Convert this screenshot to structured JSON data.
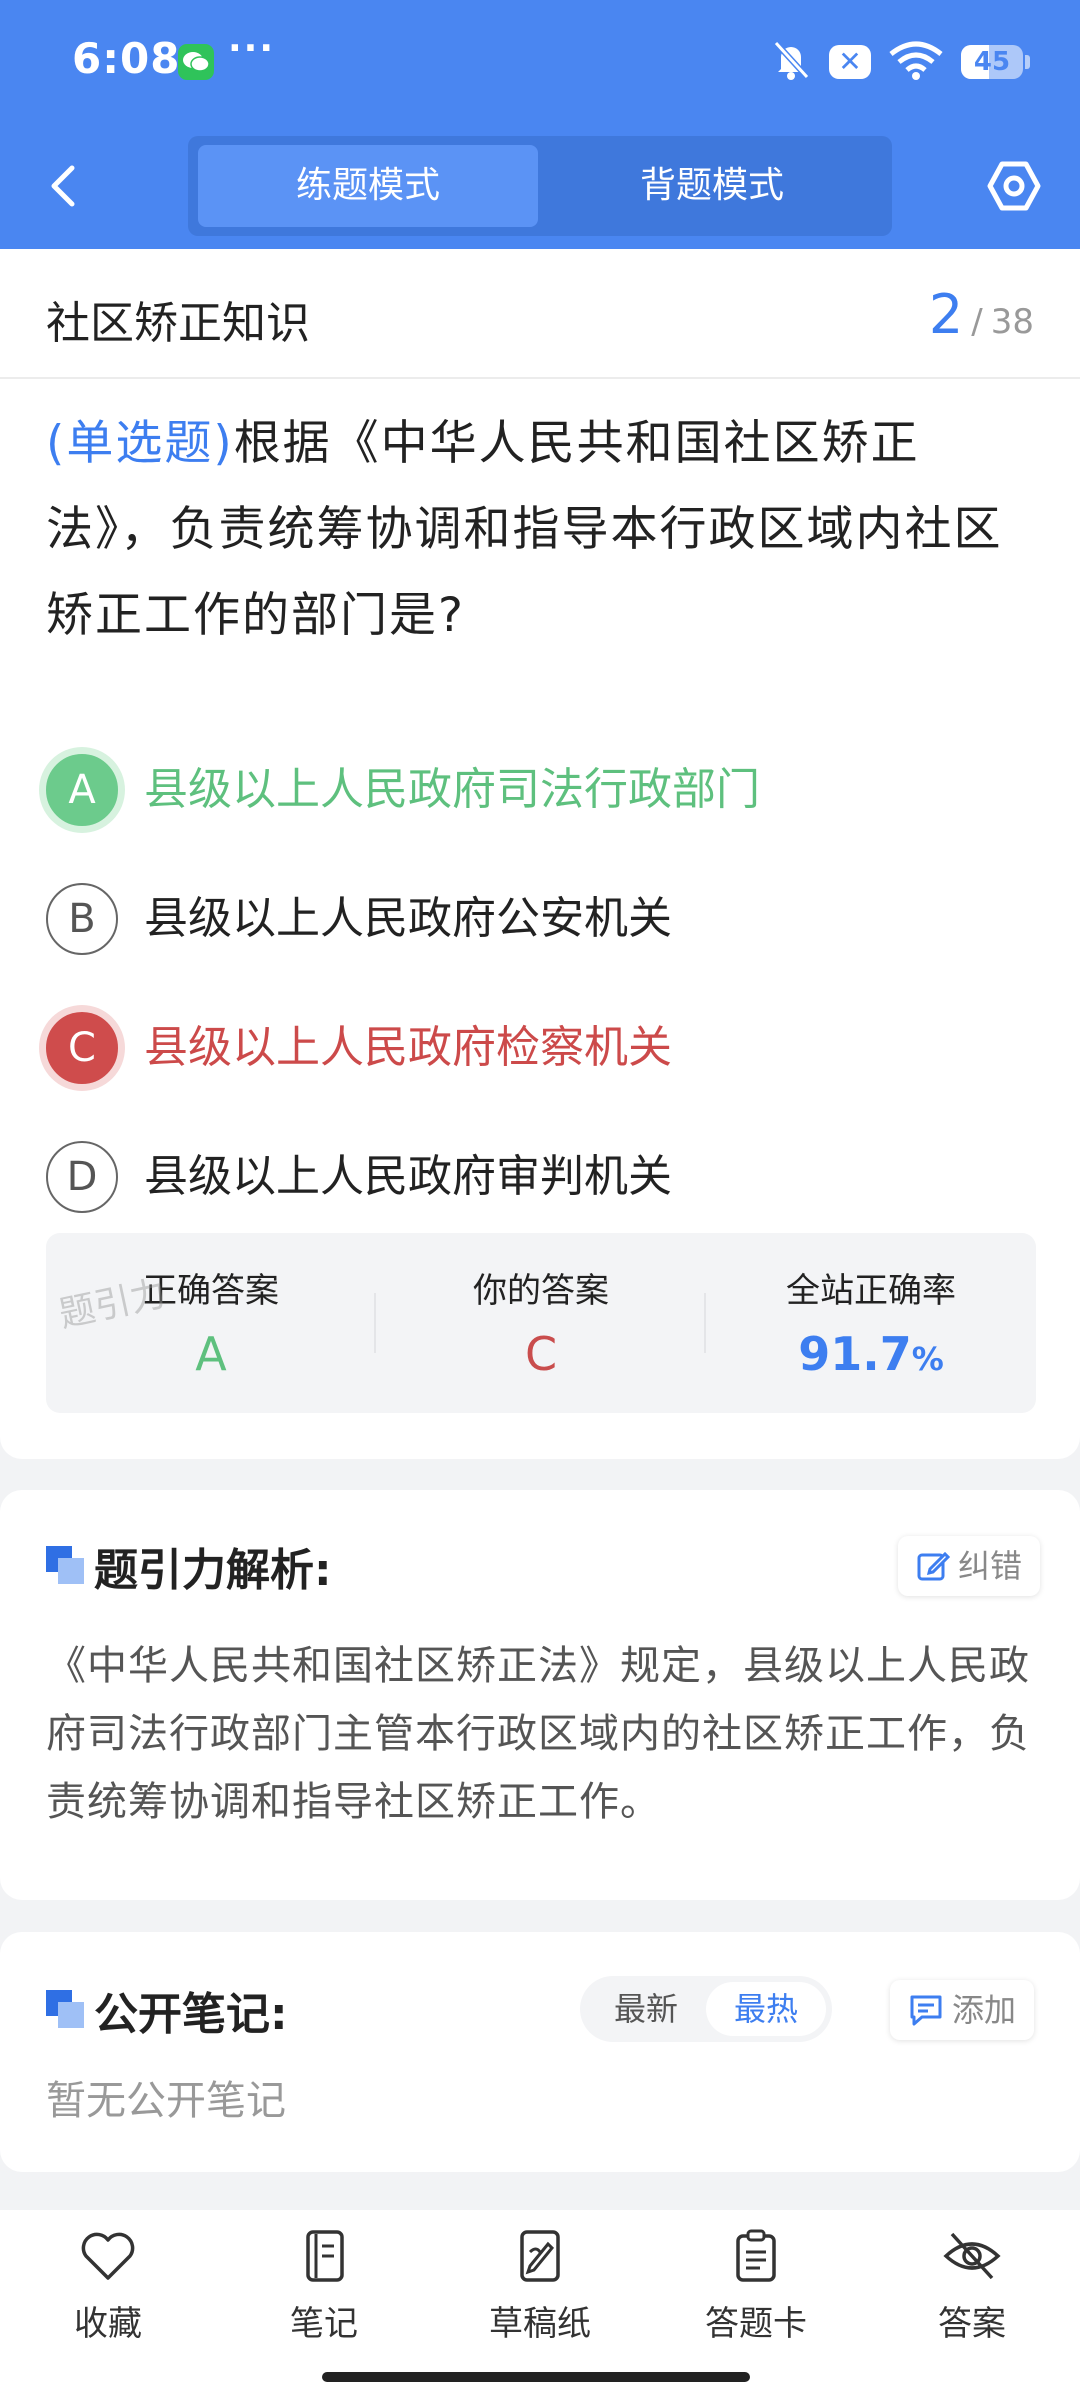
{
  "status_bar": {
    "time": "6:08",
    "more": "···",
    "sim_x": "✕",
    "battery": 45
  },
  "header": {
    "tabs": [
      {
        "label": "练题模式",
        "active": true
      },
      {
        "label": "背题模式",
        "active": false
      }
    ]
  },
  "question": {
    "category": "社区矫正知识",
    "current": "2",
    "separator": "/",
    "total": "38",
    "type": "(单选题)",
    "text": "根据《中华人民共和国社区矫正法》，负责统筹协调和指导本行政区域内社区矫正工作的部门是?",
    "options": [
      {
        "letter": "A",
        "text": "县级以上人民政府司法行政部门",
        "state": "correct"
      },
      {
        "letter": "B",
        "text": "县级以上人民政府公安机关",
        "state": "normal"
      },
      {
        "letter": "C",
        "text": "县级以上人民政府检察机关",
        "state": "wrong"
      },
      {
        "letter": "D",
        "text": "县级以上人民政府审判机关",
        "state": "normal"
      }
    ]
  },
  "result": {
    "watermark": "题引力",
    "correct_label": "正确答案",
    "correct_value": "A",
    "yours_label": "你的答案",
    "yours_value": "C",
    "rate_label": "全站正确率",
    "rate_value": "91.7",
    "rate_unit": "%"
  },
  "analysis": {
    "title": "题引力解析:",
    "report_label": "纠错",
    "text": "《中华人民共和国社区矫正法》规定，县级以上人民政府司法行政部门主管本行政区域内的社区矫正工作，负责统筹协调和指导社区矫正工作。"
  },
  "notes": {
    "title": "公开笔记:",
    "sort_latest": "最新",
    "sort_hot": "最热",
    "add_label": "添加",
    "empty": "暂无公开笔记"
  },
  "bottom_nav": [
    {
      "icon": "heart-icon",
      "label": "收藏"
    },
    {
      "icon": "notebook-icon",
      "label": "笔记"
    },
    {
      "icon": "draft-icon",
      "label": "草稿纸"
    },
    {
      "icon": "answer-card-icon",
      "label": "答题卡"
    },
    {
      "icon": "eye-off-icon",
      "label": "答案"
    }
  ],
  "colors": {
    "primary": "#4a86f1",
    "correct": "#5ec07e",
    "wrong": "#cc4a4a",
    "accent": "#3d7ef0"
  }
}
